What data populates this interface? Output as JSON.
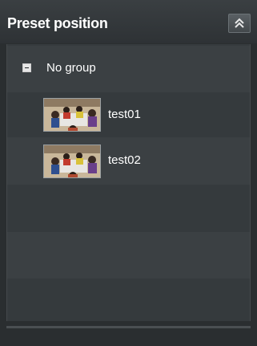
{
  "panel": {
    "title": "Preset position",
    "collapse_icon": "double-chevron-up-icon"
  },
  "group": {
    "toggle_icon": "collapse-minus-icon",
    "label": "No group"
  },
  "presets": [
    {
      "label": "test01",
      "thumbnail_icon": "camera-thumbnail"
    },
    {
      "label": "test02",
      "thumbnail_icon": "camera-thumbnail"
    }
  ],
  "colors": {
    "background": "#2a2e30",
    "row_light": "#3b4043",
    "row_dark": "#353a3d",
    "text": "#ffffff"
  }
}
